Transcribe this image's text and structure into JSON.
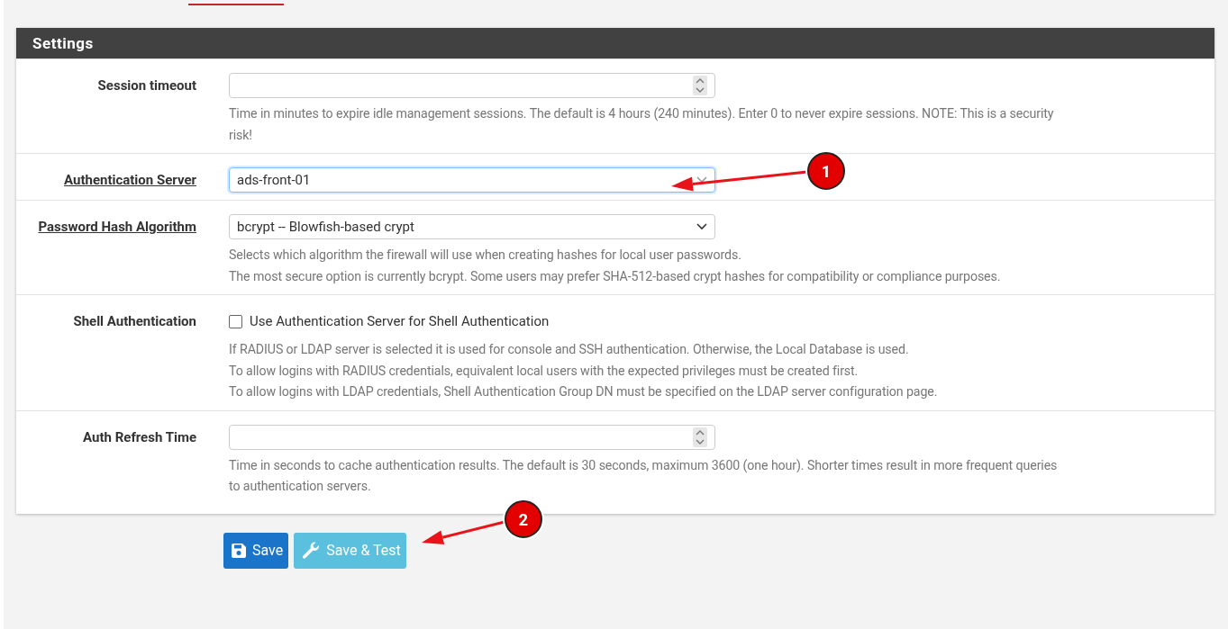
{
  "panel": {
    "title": "Settings"
  },
  "rows": [
    {
      "label": "Session timeout",
      "link": false,
      "kind": "number",
      "value": "",
      "help": [
        "Time in minutes to expire idle management sessions. The default is 4 hours (240 minutes). Enter 0 to never expire sessions. NOTE: This is a security",
        "risk!"
      ]
    },
    {
      "label": "Authentication Server",
      "link": true,
      "kind": "select",
      "value": "ads-front-01",
      "focused": true,
      "help": []
    },
    {
      "label": "Password Hash Algorithm",
      "link": true,
      "kind": "select",
      "value": "bcrypt -- Blowfish-based crypt",
      "focused": false,
      "help": [
        "Selects which algorithm the firewall will use when creating hashes for local user passwords.",
        "The most secure option is currently bcrypt. Some users may prefer SHA-512-based crypt hashes for compatibility or compliance purposes."
      ]
    },
    {
      "label": "Shell Authentication",
      "link": false,
      "kind": "checkbox",
      "checked": false,
      "text": "Use Authentication Server for Shell Authentication",
      "help": [
        "If RADIUS or LDAP server is selected it is used for console and SSH authentication. Otherwise, the Local Database is used.",
        "To allow logins with RADIUS credentials, equivalent local users with the expected privileges must be created first.",
        "To allow logins with LDAP credentials, Shell Authentication Group DN must be specified on the LDAP server configuration page."
      ]
    },
    {
      "label": "Auth Refresh Time",
      "link": false,
      "kind": "number",
      "value": "",
      "help": [
        "Time in seconds to cache authentication results. The default is 30 seconds, maximum 3600 (one hour). Shorter times result in more frequent queries",
        "to authentication servers."
      ]
    }
  ],
  "buttons": [
    {
      "label": "Save",
      "kind": "primary"
    },
    {
      "label": "Save & Test",
      "kind": "info"
    }
  ],
  "annotations": [
    {
      "label": "1"
    },
    {
      "label": "2"
    }
  ]
}
